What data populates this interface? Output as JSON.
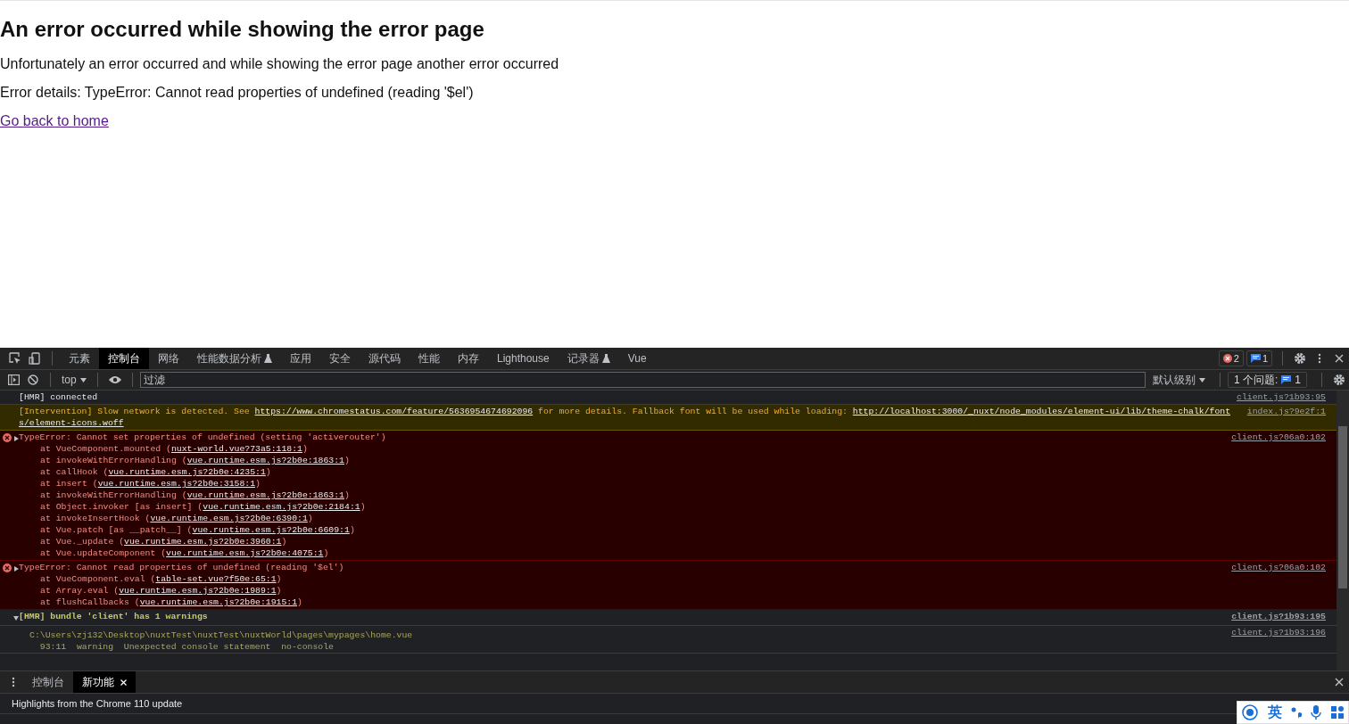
{
  "page": {
    "title": "An error occurred while showing the error page",
    "paragraphs": [
      "Unfortunately an error occurred and while showing the error page another error occurred",
      "Error details: TypeError: Cannot read properties of undefined (reading '$el')"
    ],
    "link": "Go back to home"
  },
  "devtools": {
    "tabs": [
      {
        "label": "元素",
        "selected": false,
        "experimental": false
      },
      {
        "label": "控制台",
        "selected": true,
        "experimental": false
      },
      {
        "label": "网络",
        "selected": false,
        "experimental": false
      },
      {
        "label": "性能数据分析",
        "selected": false,
        "experimental": true
      },
      {
        "label": "应用",
        "selected": false,
        "experimental": false
      },
      {
        "label": "安全",
        "selected": false,
        "experimental": false
      },
      {
        "label": "源代码",
        "selected": false,
        "experimental": false
      },
      {
        "label": "性能",
        "selected": false,
        "experimental": false
      },
      {
        "label": "内存",
        "selected": false,
        "experimental": false
      },
      {
        "label": "Lighthouse",
        "selected": false,
        "experimental": false
      },
      {
        "label": "记录器",
        "selected": false,
        "experimental": true
      },
      {
        "label": "Vue",
        "selected": false,
        "experimental": false
      }
    ],
    "error_count": "2",
    "message_count": "1",
    "context": "top",
    "filter": {
      "placeholder": "过滤"
    },
    "level_menu": "默认级别",
    "issues_label": "1 个问题:",
    "issues_count": "1",
    "messages": [
      {
        "kind": "info",
        "parts": [
          {
            "text": "[HMR] connected"
          }
        ],
        "source": "client.js?1b93:95"
      },
      {
        "kind": "warning",
        "text_lines": [
          [
            {
              "text": "[Intervention] Slow network is detected. See "
            },
            {
              "link": "https://www.chromestatus.com/feature/5636954674692096"
            },
            {
              "text": " for more details. Fallback font will be used while loading: "
            },
            {
              "link": "http://localhost:3000/_nuxt/node_modules/element-ui/lib/theme-chalk/font"
            }
          ],
          [
            {
              "link": "s/element-icons.woff"
            }
          ]
        ],
        "source": "index.js?9e2f:1"
      },
      {
        "kind": "error",
        "expanded": false,
        "parts": [
          {
            "text": "TypeError: Cannot set properties of undefined (setting 'activerouter')"
          }
        ],
        "source": "client.js?06a0:102",
        "stack": [
          {
            "prefix": "at VueComponent.mounted (",
            "link": "nuxt-world.vue?73a5:118:1",
            "suffix": ")"
          },
          {
            "prefix": "at invokeWithErrorHandling (",
            "link": "vue.runtime.esm.js?2b0e:1863:1",
            "suffix": ")"
          },
          {
            "prefix": "at callHook (",
            "link": "vue.runtime.esm.js?2b0e:4235:1",
            "suffix": ")"
          },
          {
            "prefix": "at insert (",
            "link": "vue.runtime.esm.js?2b0e:3158:1",
            "suffix": ")"
          },
          {
            "prefix": "at invokeWithErrorHandling (",
            "link": "vue.runtime.esm.js?2b0e:1863:1",
            "suffix": ")"
          },
          {
            "prefix": "at Object.invoker [as insert] (",
            "link": "vue.runtime.esm.js?2b0e:2184:1",
            "suffix": ")"
          },
          {
            "prefix": "at invokeInsertHook (",
            "link": "vue.runtime.esm.js?2b0e:6390:1",
            "suffix": ")"
          },
          {
            "prefix": "at Vue.patch [as __patch__] (",
            "link": "vue.runtime.esm.js?2b0e:6609:1",
            "suffix": ")"
          },
          {
            "prefix": "at Vue._update (",
            "link": "vue.runtime.esm.js?2b0e:3960:1",
            "suffix": ")"
          },
          {
            "prefix": "at Vue.updateComponent (",
            "link": "vue.runtime.esm.js?2b0e:4075:1",
            "suffix": ")"
          }
        ]
      },
      {
        "kind": "error",
        "expanded": false,
        "parts": [
          {
            "text": "TypeError: Cannot read properties of undefined (reading '$el')"
          }
        ],
        "source": "client.js?06a0:102",
        "stack": [
          {
            "prefix": "at VueComponent.eval (",
            "link": "table-set.vue?f50e:65:1",
            "suffix": ")"
          },
          {
            "prefix": "at Array.eval (",
            "link": "vue.runtime.esm.js?2b0e:1989:1",
            "suffix": ")"
          },
          {
            "prefix": "at flushCallbacks (",
            "link": "vue.runtime.esm.js?2b0e:1915:1",
            "suffix": ")"
          }
        ]
      },
      {
        "kind": "group",
        "expanded": true,
        "parts": [
          {
            "text": "[HMR] bundle 'client' has 1 warnings"
          }
        ],
        "source": "client.js?1b93:195"
      },
      {
        "kind": "detail",
        "lines": [
          "C:\\Users\\zj132\\Desktop\\nuxtTest\\nuxtTest\\nuxtWorld\\pages\\mypages\\home.vue",
          "  93:11  warning  Unexpected console statement  no-console"
        ],
        "source": "client.js?1b93:196"
      }
    ]
  },
  "drawer": {
    "tabs": [
      {
        "label": "控制台",
        "selected": false,
        "closable": false
      },
      {
        "label": "新功能",
        "selected": true,
        "closable": true
      }
    ],
    "content": "Highlights from the Chrome 110 update"
  },
  "ime": {
    "label": "英"
  }
}
